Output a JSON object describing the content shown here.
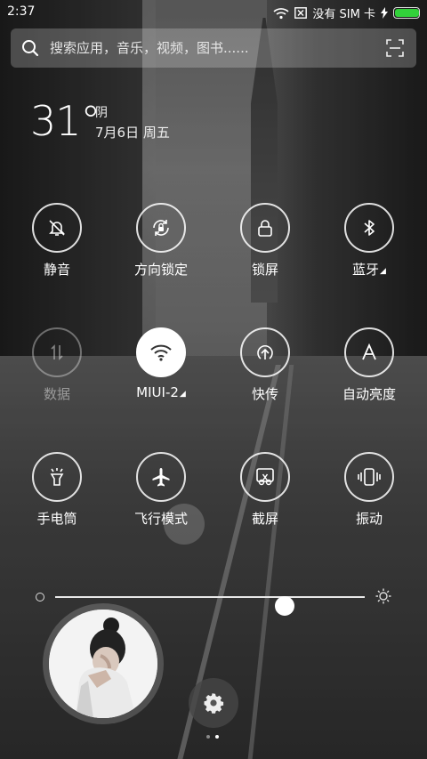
{
  "status": {
    "time": "2:37",
    "carrier": "没有 SIM 卡",
    "battery_level": 1.0,
    "battery_color": "#32d13a"
  },
  "search": {
    "placeholder": "搜索应用，音乐，视频，图书......",
    "icon": "search-icon",
    "scan_icon": "scan-icon"
  },
  "weather": {
    "temperature": "31°",
    "condition": "阴",
    "date": "7月6日 周五"
  },
  "toggles": [
    {
      "label": "静音",
      "icon": "mute-bell-icon",
      "state": "off"
    },
    {
      "label": "方向锁定",
      "icon": "rotation-lock-icon",
      "state": "off"
    },
    {
      "label": "锁屏",
      "icon": "lock-icon",
      "state": "off"
    },
    {
      "label": "蓝牙",
      "icon": "bluetooth-icon",
      "state": "off",
      "has_menu": true
    },
    {
      "label": "数据",
      "icon": "mobile-data-icon",
      "state": "disabled"
    },
    {
      "label": "MIUI-2",
      "icon": "wifi-icon",
      "state": "on",
      "has_menu": true
    },
    {
      "label": "快传",
      "icon": "mi-drop-icon",
      "state": "off"
    },
    {
      "label": "自动亮度",
      "icon": "auto-brightness-icon",
      "state": "off"
    },
    {
      "label": "手电筒",
      "icon": "flashlight-icon",
      "state": "off"
    },
    {
      "label": "飞行模式",
      "icon": "airplane-icon",
      "state": "off"
    },
    {
      "label": "截屏",
      "icon": "screenshot-icon",
      "state": "off"
    },
    {
      "label": "振动",
      "icon": "vibrate-icon",
      "state": "off"
    }
  ],
  "brightness": {
    "level": 0.74,
    "low_icon": "brightness-low-icon",
    "high_icon": "brightness-high-icon"
  },
  "settings_icon": "gear-icon",
  "pager": {
    "count": 2,
    "active": 1
  }
}
